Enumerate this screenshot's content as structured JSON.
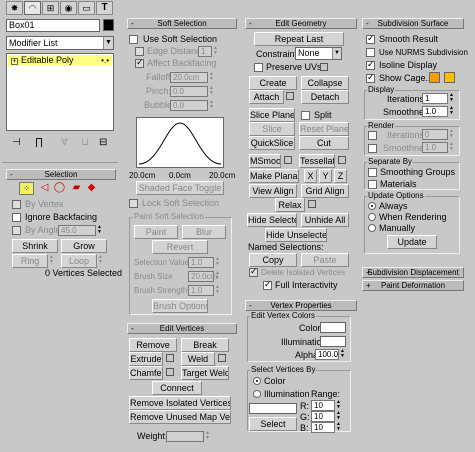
{
  "top_tabs": {
    "icons": [
      "create-tab-icon",
      "modify-tab-icon",
      "hierarchy-tab-icon",
      "motion-tab-icon",
      "display-tab-icon",
      "utilities-tab-icon"
    ]
  },
  "object": {
    "name": "Box01",
    "color": "#000000"
  },
  "modifier_list": "Modifier List",
  "stack": {
    "item": "Editable Poly",
    "item_color": "#ffff80"
  },
  "stack_toolbar": [
    "pin-stack-icon",
    "show-end-result-icon",
    "make-unique-icon",
    "remove-modifier-icon",
    "configure-modifier-sets-icon"
  ],
  "selection": {
    "title": "Selection",
    "by_vertex": "By Vertex",
    "ignore_backfacing": "Ignore Backfacing",
    "by_angle": "By Angle:",
    "angle": "45.0",
    "shrink": "Shrink",
    "grow": "Grow",
    "ring": "Ring",
    "loop": "Loop",
    "status": "0 Vertices Selected"
  },
  "soft_selection": {
    "title": "Soft Selection",
    "use": "Use Soft Selection",
    "edge_distance": "Edge Distance:",
    "edge_val": "1",
    "affect_backfacing": "Affect Backfacing",
    "falloff": "Falloff:",
    "falloff_val": "20.0cm",
    "pinch": "Pinch:",
    "pinch_val": "0.0",
    "bubble": "Bubble:",
    "bubble_val": "0.0",
    "axis_left": "20.0cm",
    "axis_mid": "0.0cm",
    "axis_right": "20.0cm",
    "shaded_face": "Shaded Face Toggle",
    "lock": "Lock Soft Selection",
    "paint_group": "Paint Soft Selection",
    "paint": "Paint",
    "blur": "Blur",
    "revert": "Revert",
    "sel_value": "Selection Value",
    "sel_value_val": "1.0",
    "brush_size": "Brush Size",
    "brush_size_val": "20.0cm",
    "brush_strength": "Brush Strength",
    "brush_strength_val": "1.0",
    "brush_options": "Brush Options"
  },
  "edit_vertices": {
    "title": "Edit Vertices",
    "remove": "Remove",
    "break": "Break",
    "extrude": "Extrude",
    "weld": "Weld",
    "chamfer": "Chamfer",
    "target_weld": "Target Weld",
    "connect": "Connect",
    "remove_isolated": "Remove Isolated Vertices",
    "remove_unused": "Remove Unused Map Verts",
    "weight": "Weight:"
  },
  "edit_geometry": {
    "title": "Edit Geometry",
    "repeat_last": "Repeat Last",
    "constraints": "Constraints:",
    "constraints_val": "None",
    "preserve_uvs": "Preserve UVs",
    "create": "Create",
    "collapse": "Collapse",
    "attach": "Attach",
    "detach": "Detach",
    "slice_plane": "Slice Plane",
    "split": "Split",
    "slice": "Slice",
    "reset_plane": "Reset Plane",
    "quickslice": "QuickSlice",
    "cut": "Cut",
    "msmooth": "MSmooth",
    "tessellate": "Tessellate",
    "make_planar": "Make Planar",
    "x": "X",
    "y": "Y",
    "z": "Z",
    "view_align": "View Align",
    "grid_align": "Grid Align",
    "relax": "Relax",
    "hide_selected": "Hide Selected",
    "unhide_all": "Unhide All",
    "hide_unselected": "Hide Unselected",
    "named_selections": "Named Selections:",
    "copy": "Copy",
    "paste": "Paste",
    "delete_isolated": "Delete Isolated Vertices",
    "full_interactivity": "Full Interactivity"
  },
  "vertex_properties": {
    "title": "Vertex Properties",
    "edit_colors": "Edit Vertex Colors",
    "color": "Color:",
    "illumination": "Illumination:",
    "alpha": "Alpha:",
    "alpha_val": "100.0",
    "select_by": "Select Vertices By",
    "opt_color": "Color",
    "opt_illumination": "Illumination",
    "range": "Range:",
    "r": "R:",
    "g": "G:",
    "b": "B:",
    "rv": "10",
    "gv": "10",
    "bv": "10",
    "select": "Select"
  },
  "subdivision_surface": {
    "title": "Subdivision Surface",
    "smooth_result": "Smooth Result",
    "use_nurms": "Use NURMS Subdivision",
    "isoline": "Isoline Display",
    "show_cage": "Show Cage......",
    "cage_color1": "#f0a000",
    "cage_color2": "#f8c000",
    "display": "Display",
    "iterations": "Iterations:",
    "iter_val": "1",
    "smoothness": "Smoothness:",
    "smooth_val": "1.0",
    "render": "Render",
    "r_iterations": "Iterations:",
    "r_iter_val": "0",
    "r_smoothness": "Smoothness:",
    "r_smooth_val": "1.0",
    "separate_by": "Separate By",
    "smoothing_groups": "Smoothing Groups",
    "materials": "Materials",
    "update_options": "Update Options",
    "always": "Always",
    "when_rendering": "When Rendering",
    "manually": "Manually",
    "update": "Update"
  },
  "collapsed": {
    "subdivision_displacement": "Subdivision Displacement",
    "paint_deformation": "Paint Deformation"
  }
}
